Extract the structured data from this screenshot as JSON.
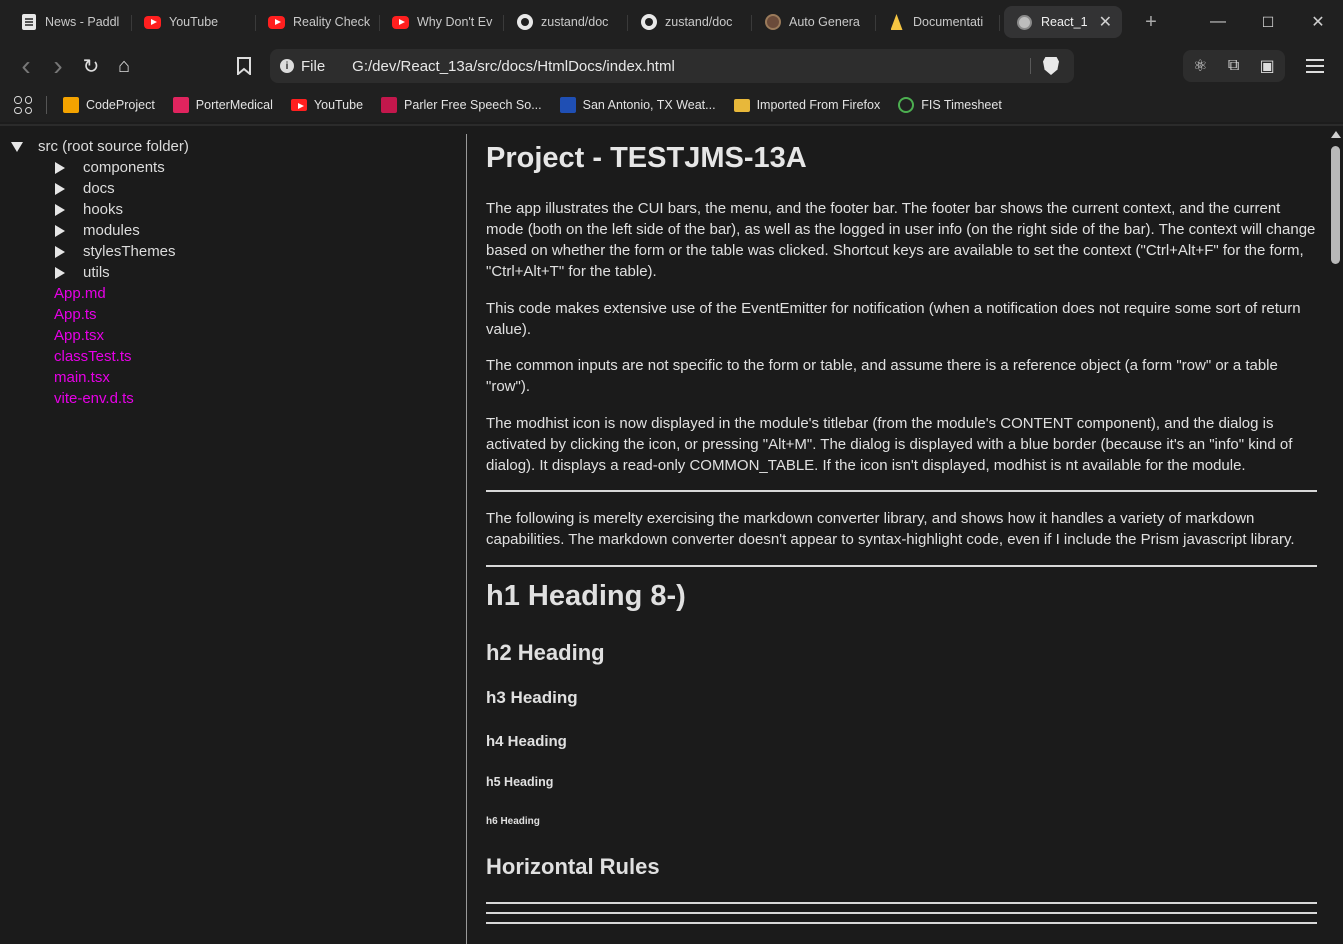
{
  "tabs": [
    {
      "label": "News - Paddl",
      "icon": "news-icon"
    },
    {
      "label": "YouTube",
      "icon": "youtube-icon"
    },
    {
      "label": "Reality Check",
      "icon": "youtube-icon"
    },
    {
      "label": "Why Don't Ev",
      "icon": "youtube-icon"
    },
    {
      "label": "zustand/doc",
      "icon": "github-icon"
    },
    {
      "label": "zustand/doc",
      "icon": "github-icon"
    },
    {
      "label": "Auto Genera",
      "icon": "auto-icon"
    },
    {
      "label": "Documentati",
      "icon": "docs-icon"
    },
    {
      "label": "React_1",
      "icon": "globe-icon",
      "active": true
    }
  ],
  "window_controls": {
    "minimize": "—",
    "maximize": "☐",
    "close": "✕"
  },
  "toolbar": {
    "back": "‹",
    "forward": "›",
    "reload": "↻",
    "home": "⌂",
    "bookmark": "🔖"
  },
  "address": {
    "scheme": "File",
    "url": "G:/dev/React_13a/src/docs/HtmlDocs/index.html"
  },
  "bookmarks": [
    {
      "label": "CodeProject",
      "color": "#f4a300"
    },
    {
      "label": "PorterMedical",
      "color": "#e0245e"
    },
    {
      "label": "YouTube",
      "color": "#ff1f1f"
    },
    {
      "label": "Parler Free Speech So...",
      "color": "#c3174c"
    },
    {
      "label": "San Antonio, TX Weat...",
      "color": "#1f4fb4"
    },
    {
      "label": "Imported From Firefox",
      "color": "#e8b83a"
    },
    {
      "label": "FIS Timesheet",
      "color": "#4caf50"
    }
  ],
  "tree": {
    "root": "src (root source folder)",
    "folders": [
      "components",
      "docs",
      "hooks",
      "modules",
      "stylesThemes",
      "utils"
    ],
    "files": [
      "App.md",
      "App.ts",
      "App.tsx",
      "classTest.ts",
      "main.tsx",
      "vite-env.d.ts"
    ]
  },
  "doc": {
    "title": "Project - TESTJMS-13A",
    "paragraphs": [
      "The app illustrates the CUI bars, the menu, and the footer bar. The footer bar shows the current context, and the current mode (both on the left side of the bar), as well as the logged in user info (on the right side of the bar). The context will change based on whether the form or the table was clicked. Shortcut keys are available to set the context (\"Ctrl+Alt+F\" for the form, \"Ctrl+Alt+T\" for the table).",
      "This code makes extensive use of the EventEmitter for notification (when a notification does not require some sort of return value).",
      "The common inputs are not specific to the form or table, and assume there is a reference object (a form \"row\" or a table \"row\").",
      "The modhist icon is now displayed in the module's titlebar (from the module's CONTENT component), and the dialog is activated by clicking the icon, or pressing \"Alt+M\". The dialog is displayed with a blue border (because it's an \"info\" kind of dialog). It displays a read-only COMMON_TABLE. If the icon isn't displayed, modhist is nt available for the module."
    ],
    "intro2": "The following is merelty exercising the markdown converter library, and shows how it handles a variety of markdown capabilities. The markdown converter doesn't appear to syntax-highlight code, even if I include the Prism javascript library.",
    "h1": "h1 Heading 8-)",
    "h2": "h2 Heading",
    "h3": "h3 Heading",
    "h4": "h4 Heading",
    "h5": "h5 Heading",
    "h6": "h6 Heading",
    "hr_title": "Horizontal Rules"
  },
  "colors": {
    "file_link": "#e600e6",
    "background": "#1b1b1b",
    "text": "#e0e0e0"
  }
}
